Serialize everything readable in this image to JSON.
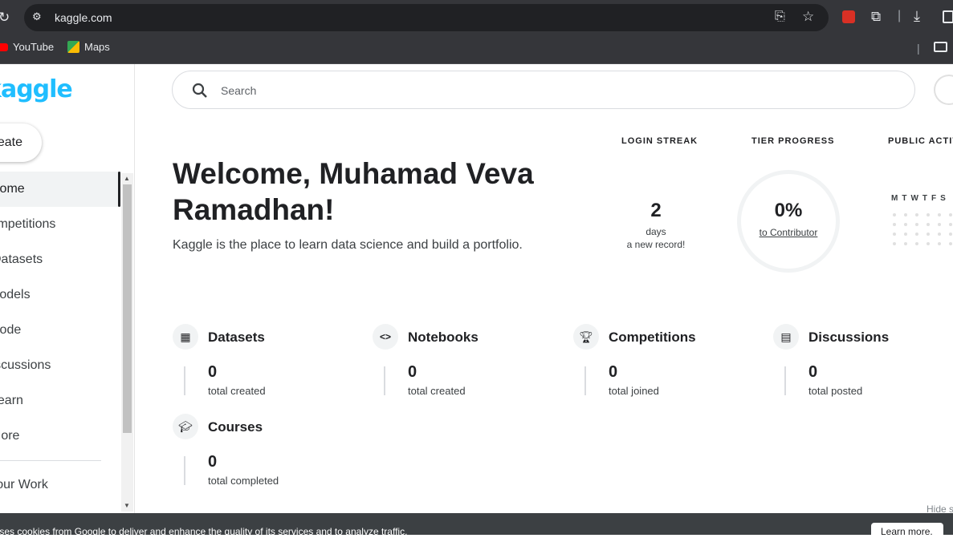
{
  "browser": {
    "url": "kaggle.com",
    "bookmarks": [
      {
        "label": "YouTube",
        "icon": "youtube-icon"
      },
      {
        "label": "Maps",
        "icon": "maps-icon"
      }
    ]
  },
  "sidebar": {
    "logo": "kaggle",
    "create_label": "Create",
    "items": [
      {
        "label": "Home",
        "active": true
      },
      {
        "label": "Competitions"
      },
      {
        "label": "Datasets"
      },
      {
        "label": "Models"
      },
      {
        "label": "Code"
      },
      {
        "label": "Discussions"
      },
      {
        "label": "Learn"
      },
      {
        "label": "More"
      }
    ],
    "your_work": "Your Work"
  },
  "search": {
    "placeholder": "Search"
  },
  "main": {
    "welcome": "Welcome, Muhamad Veva Ramadhan!",
    "subtitle": "Kaggle is the place to learn data science and build a portfolio."
  },
  "stats": {
    "login_streak": {
      "heading": "LOGIN STREAK",
      "value": "2",
      "unit": "days",
      "note": "a new record!"
    },
    "tier_progress": {
      "heading": "TIER PROGRESS",
      "value": "0%",
      "note": "to Contributor"
    },
    "public_activity": {
      "heading": "PUBLIC ACTIVITY",
      "days": [
        "M",
        "T",
        "W",
        "T",
        "F",
        "S"
      ]
    }
  },
  "cards": [
    {
      "title": "Datasets",
      "icon": "table-icon",
      "value": "0",
      "sub": "total created"
    },
    {
      "title": "Notebooks",
      "icon": "code-icon",
      "value": "0",
      "sub": "total created"
    },
    {
      "title": "Competitions",
      "icon": "trophy-icon",
      "value": "0",
      "sub": "total joined"
    },
    {
      "title": "Discussions",
      "icon": "comment-icon",
      "value": "0",
      "sub": "total posted"
    },
    {
      "title": "Courses",
      "icon": "school-icon",
      "value": "0",
      "sub": "total completed"
    }
  ],
  "hide_label": "Hide sidebar",
  "cookie": {
    "text": "Kaggle uses cookies from Google to deliver and enhance the quality of its services and to analyze traffic.",
    "button": "Learn more."
  }
}
